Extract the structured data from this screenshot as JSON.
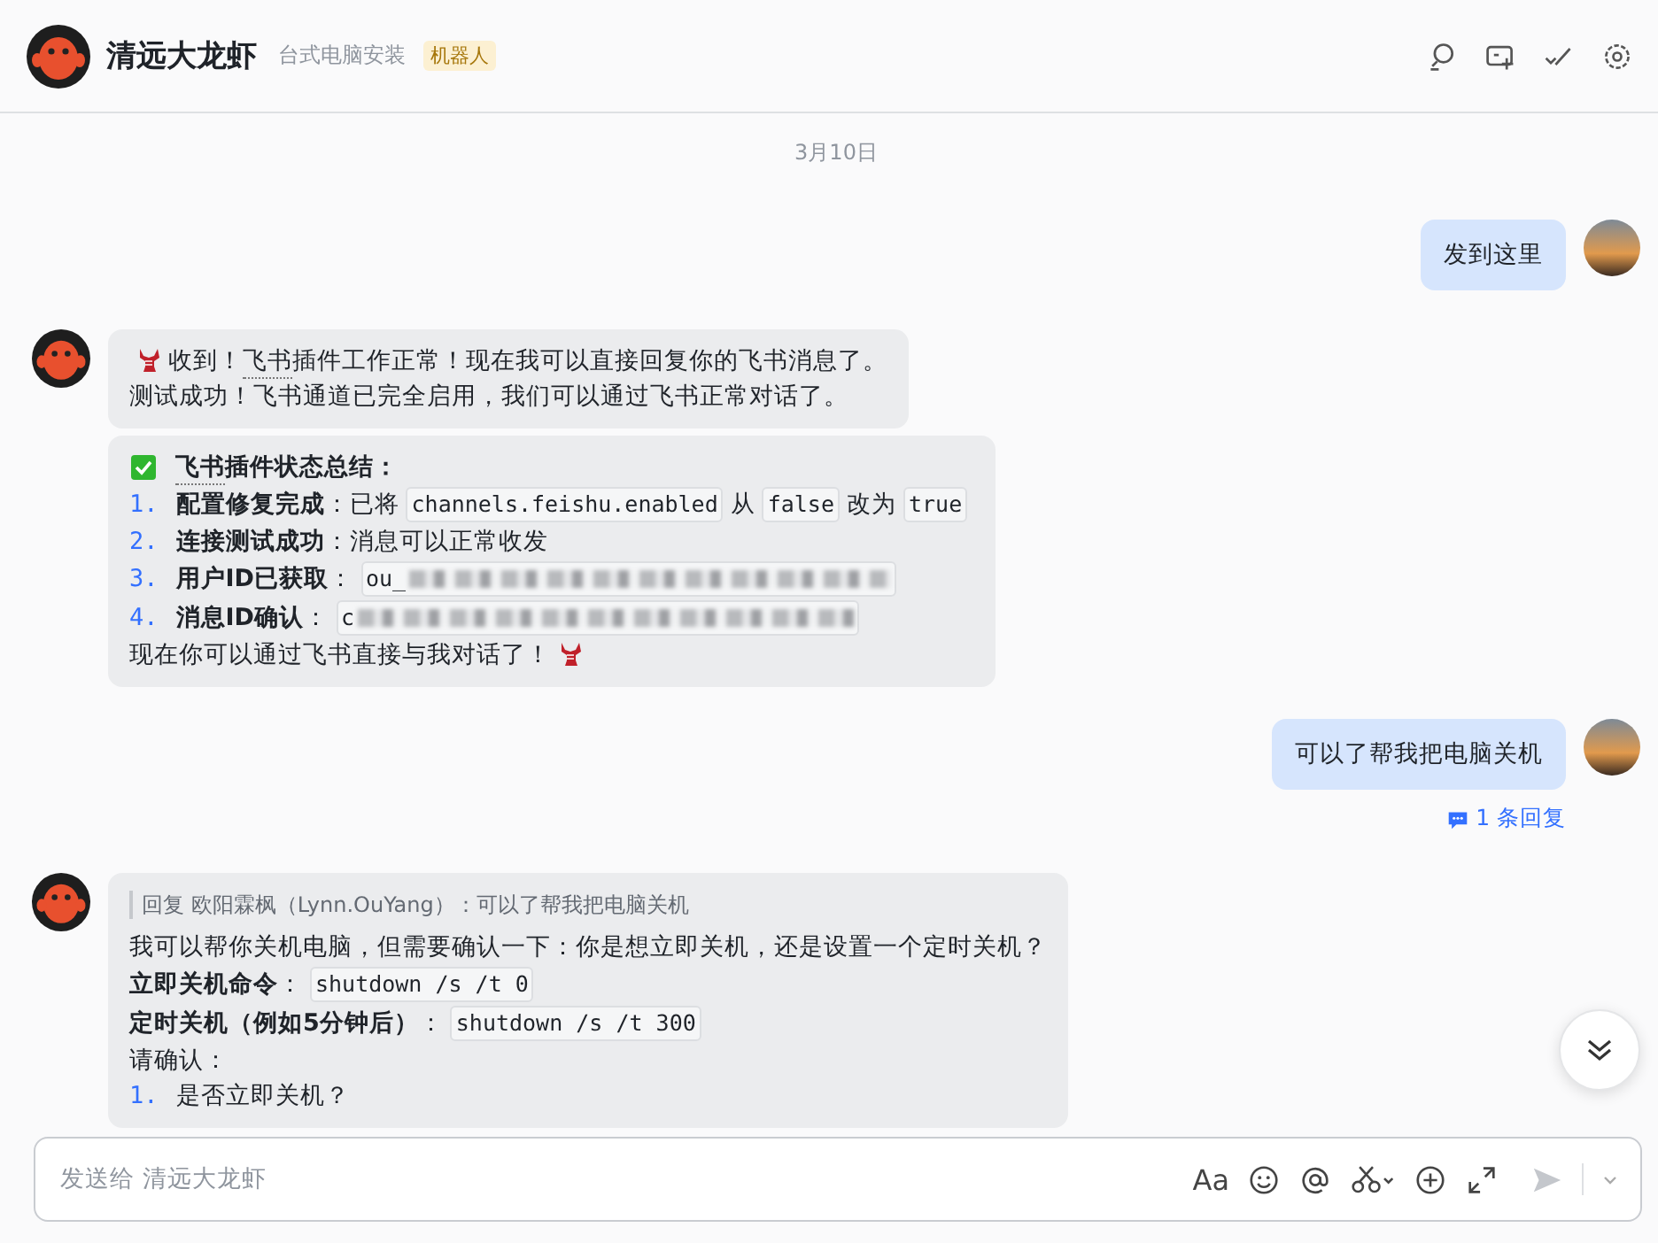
{
  "header": {
    "title": "清远大龙虾",
    "subtitle": "台式电脑安装",
    "tag": "机器人"
  },
  "messages": [
    {
      "kind": "date",
      "text": "3月10日"
    },
    {
      "kind": "outgoing",
      "text": "发到这里"
    },
    {
      "kind": "bot",
      "bubbles": [
        {
          "lines": [
            [
              {
                "kind": "lobster"
              },
              {
                "kind": "text",
                "text": " 收到！"
              },
              {
                "kind": "term",
                "text": "飞书"
              },
              {
                "kind": "text",
                "text": "插件工作正常！现在我可以直接回复你的飞书消息了。"
              }
            ],
            [
              {
                "kind": "text",
                "text": "测试成功！飞书通道已完全启用，我们可以通过飞书正常对话了。"
              }
            ]
          ]
        },
        {
          "lines": [
            [
              {
                "kind": "check"
              },
              {
                "kind": "boldterm",
                "text": "飞书"
              },
              {
                "kind": "bold",
                "text": "插件状态总结："
              }
            ],
            [
              {
                "kind": "num",
                "text": "1."
              },
              {
                "kind": "bold",
                "text": "配置修复完成"
              },
              {
                "kind": "text",
                "text": "：已将"
              },
              {
                "kind": "code",
                "text": "channels.feishu.enabled"
              },
              {
                "kind": "text",
                "text": "从"
              },
              {
                "kind": "code",
                "text": "false"
              },
              {
                "kind": "text",
                "text": "改为"
              },
              {
                "kind": "code",
                "text": "true"
              }
            ],
            [
              {
                "kind": "num",
                "text": "2."
              },
              {
                "kind": "bold",
                "text": "连接测试成功"
              },
              {
                "kind": "text",
                "text": "：消息可以正常收发"
              }
            ],
            [
              {
                "kind": "num",
                "text": "3."
              },
              {
                "kind": "bold",
                "text": "用户ID已获取"
              },
              {
                "kind": "text",
                "text": "："
              },
              {
                "kind": "redacted",
                "text": "ou_"
              }
            ],
            [
              {
                "kind": "num",
                "text": "4."
              },
              {
                "kind": "bold",
                "text": "消息ID确认"
              },
              {
                "kind": "text",
                "text": "："
              },
              {
                "kind": "redacted",
                "text": "c"
              }
            ],
            [
              {
                "kind": "text",
                "text": "现在你可以通过飞书直接与我对话了！"
              },
              {
                "kind": "lobster"
              }
            ]
          ]
        }
      ]
    },
    {
      "kind": "outgoing",
      "text": "可以了帮我把电脑关机",
      "replies": "1 条回复"
    },
    {
      "kind": "bot",
      "quote": "回复 欧阳霖枫（Lynn.OuYang）：可以了帮我把电脑关机",
      "bubbles": [
        {
          "lines": [
            [
              {
                "kind": "text",
                "text": "我可以帮你关机电脑，但需要确认一下：你是想立即关机，还是设置一个定时关机？"
              }
            ],
            [
              {
                "kind": "bold",
                "text": "立即关机命令"
              },
              {
                "kind": "text",
                "text": "："
              },
              {
                "kind": "code",
                "text": "shutdown /s /t 0"
              }
            ],
            [
              {
                "kind": "bold",
                "text": "定时关机（例如5分钟后）"
              },
              {
                "kind": "text",
                "text": "："
              },
              {
                "kind": "code",
                "text": "shutdown /s /t 300"
              }
            ],
            [
              {
                "kind": "text",
                "text": "请确认："
              }
            ],
            [
              {
                "kind": "num",
                "text": "1."
              },
              {
                "kind": "text",
                "text": "是否立即关机？"
              }
            ]
          ]
        }
      ]
    }
  ],
  "composer": {
    "placeholder": "发送给 清远大龙虾",
    "format_label": "Aa"
  }
}
